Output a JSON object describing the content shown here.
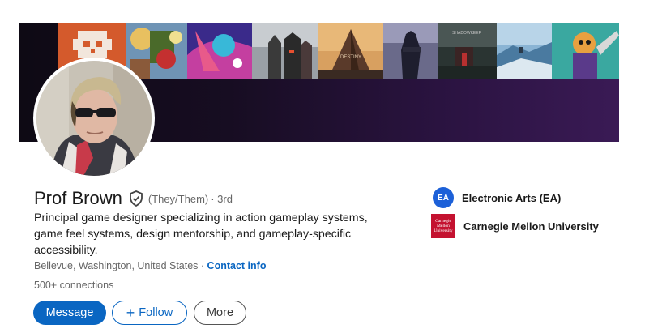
{
  "profile": {
    "name": "Prof Brown",
    "pronouns": "(They/Them)",
    "degree": "· 3rd",
    "headline": "Principal game designer specializing in action gameplay systems, game feel systems, design mentorship, and gameplay-specific accessibility.",
    "location": "Bellevue, Washington, United States",
    "location_separator": " · ",
    "contact_info": "Contact info",
    "connections": "500+ connections"
  },
  "actions": {
    "message": "Message",
    "follow": "Follow",
    "follow_icon": "+",
    "more": "More"
  },
  "organizations": [
    {
      "name": "Electronic Arts (EA)",
      "logo_text": "EA",
      "color": "#1c60d8"
    },
    {
      "name": "Carnegie Mellon University",
      "logo_text": "Carnegie Mellon University",
      "color": "#c41230"
    }
  ],
  "banner": {
    "games": [
      {
        "icon": "skull-game-art",
        "color": "#d4542a"
      },
      {
        "icon": "colorful-adventure-art",
        "color": "#6a8fb0"
      },
      {
        "icon": "neon-action-art",
        "color": "#7a3fc4"
      },
      {
        "icon": "destiny-characters-art",
        "color": "#8a8a8a"
      },
      {
        "icon": "destiny-pyramid-art",
        "color": "#c48a4a"
      },
      {
        "icon": "dark-figure-art",
        "color": "#4a4a6a"
      },
      {
        "icon": "shadowkeep-art",
        "color": "#3a4a4a"
      },
      {
        "icon": "icy-landscape-art",
        "color": "#7aa8c8"
      },
      {
        "icon": "robot-character-art",
        "color": "#3a8a8a"
      }
    ],
    "tile_labels": [
      "DESTINY",
      "SHADOWKEEP"
    ]
  }
}
